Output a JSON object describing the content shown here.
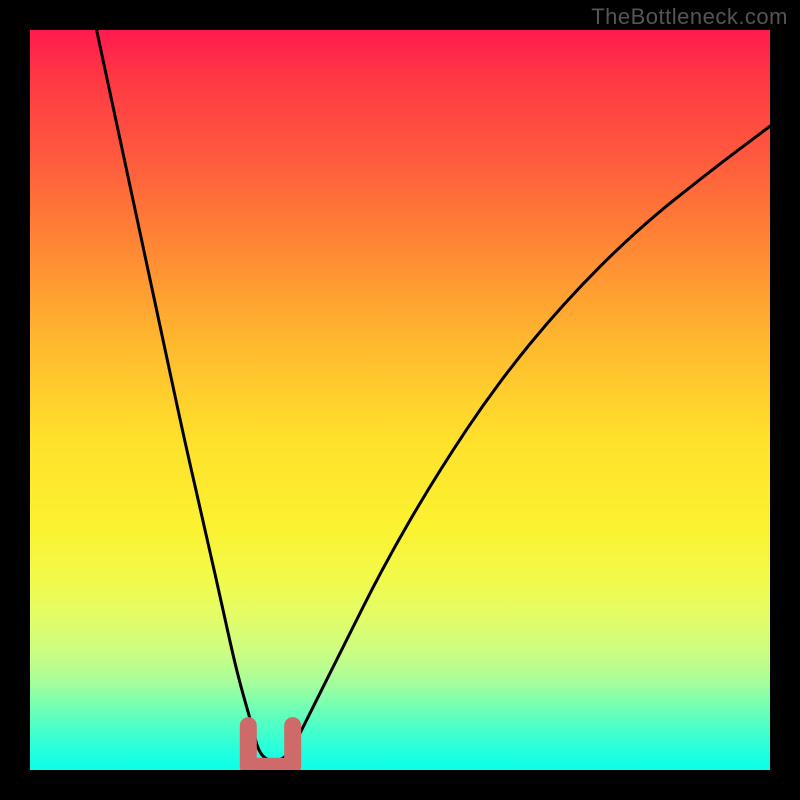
{
  "watermark": "TheBottleneck.com",
  "chart_data": {
    "type": "line",
    "title": "",
    "xlabel": "",
    "ylabel": "",
    "xlim": [
      0,
      100
    ],
    "ylim": [
      0,
      100
    ],
    "background_gradient": {
      "top": "#ff1a4f",
      "middle": "#ffe02c",
      "bottom": "#0affe8"
    },
    "series": [
      {
        "name": "bottleneck-curve",
        "color": "#000000",
        "x": [
          9,
          12,
          15,
          18,
          21,
          24,
          26,
          28,
          30,
          31,
          33,
          35,
          37,
          42,
          48,
          55,
          63,
          72,
          82,
          92,
          100
        ],
        "y": [
          100,
          86,
          72,
          58,
          44,
          31,
          22,
          13,
          6,
          2,
          1,
          2,
          6,
          16,
          28,
          40,
          52,
          63,
          73,
          81,
          87
        ]
      },
      {
        "name": "optimal-marker",
        "color": "#cf6a6a",
        "shape": "U-marker",
        "x_range": [
          29.5,
          35.5
        ],
        "y_range": [
          0.5,
          6
        ]
      }
    ]
  }
}
